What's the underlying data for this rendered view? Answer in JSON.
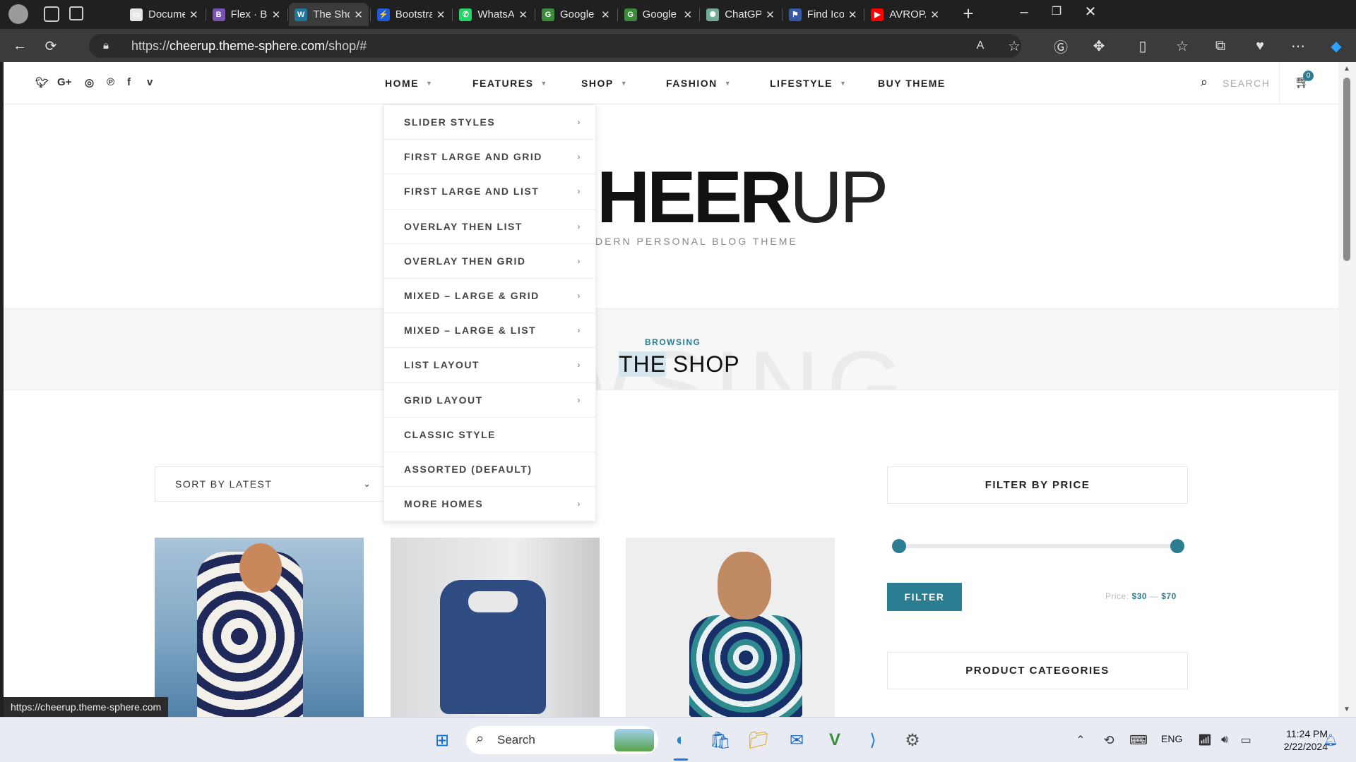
{
  "browser": {
    "tabs": [
      {
        "title": "Document",
        "fav_color": "#e6e6e6",
        "fav_glyph": "▭",
        "icon": "document-icon"
      },
      {
        "title": "Flex · Boot",
        "fav_color": "#7952b3",
        "fav_glyph": "B",
        "icon": "bootstrap-icon"
      },
      {
        "title": "The Shop",
        "fav_color": "#21759b",
        "fav_glyph": "W",
        "icon": "wordpress-icon"
      },
      {
        "title": "Bootstrap",
        "fav_color": "#1e5bd8",
        "fav_glyph": "⚡",
        "icon": "bolt-icon"
      },
      {
        "title": "WhatsApp",
        "fav_color": "#25d366",
        "fav_glyph": "✆",
        "icon": "whatsapp-icon"
      },
      {
        "title": "Google M",
        "fav_color": "#3c8a3c",
        "fav_glyph": "G",
        "icon": "google-meet-icon"
      },
      {
        "title": "Google M",
        "fav_color": "#3c8a3c",
        "fav_glyph": "G",
        "icon": "google-meet-icon"
      },
      {
        "title": "ChatGPT",
        "fav_color": "#74aa9c",
        "fav_glyph": "✺",
        "icon": "chatgpt-icon"
      },
      {
        "title": "Find Icons",
        "fav_color": "#3559a6",
        "fav_glyph": "⚑",
        "icon": "flag-icon"
      },
      {
        "title": "AVROPAD",
        "fav_color": "#ff0000",
        "fav_glyph": "▶",
        "icon": "youtube-icon"
      }
    ],
    "url_scheme": "https://",
    "url_host": "cheerup.theme-sphere.com",
    "url_path": "/shop/#",
    "status_url": "https://cheerup.theme-sphere.com"
  },
  "site": {
    "nav": [
      {
        "label": "HOME",
        "active": true
      },
      {
        "label": "FEATURES",
        "active": false
      },
      {
        "label": "SHOP",
        "active": true
      },
      {
        "label": "FASHION",
        "active": false
      },
      {
        "label": "LIFESTYLE",
        "active": false
      },
      {
        "label": "BUY THEME",
        "active": false
      }
    ],
    "search_label": "SEARCH",
    "cart_count": "0",
    "logo_left": "HEER",
    "logo_right": "UP",
    "tagline": "DERN PERSONAL BLOG THEME",
    "browsing_label": "BROWSING",
    "ghost_word": "WSING",
    "title_highlight": "THE",
    "title_rest": " SHOP",
    "home_menu": [
      {
        "label": "SLIDER STYLES",
        "sub": true
      },
      {
        "label": "FIRST LARGE AND GRID",
        "sub": true
      },
      {
        "label": "FIRST LARGE AND LIST",
        "sub": true
      },
      {
        "label": "OVERLAY THEN LIST",
        "sub": true
      },
      {
        "label": "OVERLAY THEN GRID",
        "sub": true
      },
      {
        "label": "MIXED – LARGE & GRID",
        "sub": true
      },
      {
        "label": "MIXED – LARGE & LIST",
        "sub": true
      },
      {
        "label": "LIST LAYOUT",
        "sub": true
      },
      {
        "label": "GRID LAYOUT",
        "sub": true
      },
      {
        "label": "CLASSIC STYLE",
        "sub": false
      },
      {
        "label": "ASSORTED (DEFAULT)",
        "sub": false
      },
      {
        "label": "MORE HOMES",
        "sub": true
      }
    ],
    "sort_value": "SORT BY LATEST",
    "filter_title": "FILTER BY PRICE",
    "filter_button": "FILTER",
    "price_prefix": "Price:",
    "price_min": "$30",
    "price_sep": "—",
    "price_max": "$70",
    "categories_title": "PRODUCT CATEGORIES",
    "accent": "#2b7d91"
  },
  "taskbar": {
    "search_label": "Search",
    "lang": "ENG",
    "time": "11:24 PM",
    "date": "2/22/2024"
  }
}
